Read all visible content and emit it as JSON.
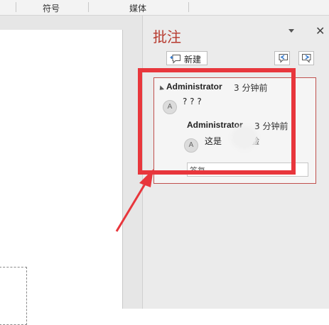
{
  "ribbon": {
    "groups": [
      "符号",
      "媒体"
    ]
  },
  "comments_pane": {
    "title": "批注",
    "new_button_label": "新建",
    "thread": {
      "author": "Administrator",
      "time": "3 分钟前",
      "avatar": "A",
      "text": "? ? ?",
      "reply": {
        "author": "Administrator",
        "time": "3 分钟前",
        "avatar": "A",
        "text": "这是",
        "text_tail": "验"
      },
      "reply_placeholder": "答复"
    }
  },
  "icons": [
    "new-comment-icon",
    "previous-comment-icon",
    "next-comment-icon",
    "close-icon",
    "pane-options-icon",
    "collapse-thread-icon"
  ],
  "colors": {
    "accent": "#b73a2f",
    "annotation": "#e8363c",
    "thread_border": "#c0504d"
  }
}
